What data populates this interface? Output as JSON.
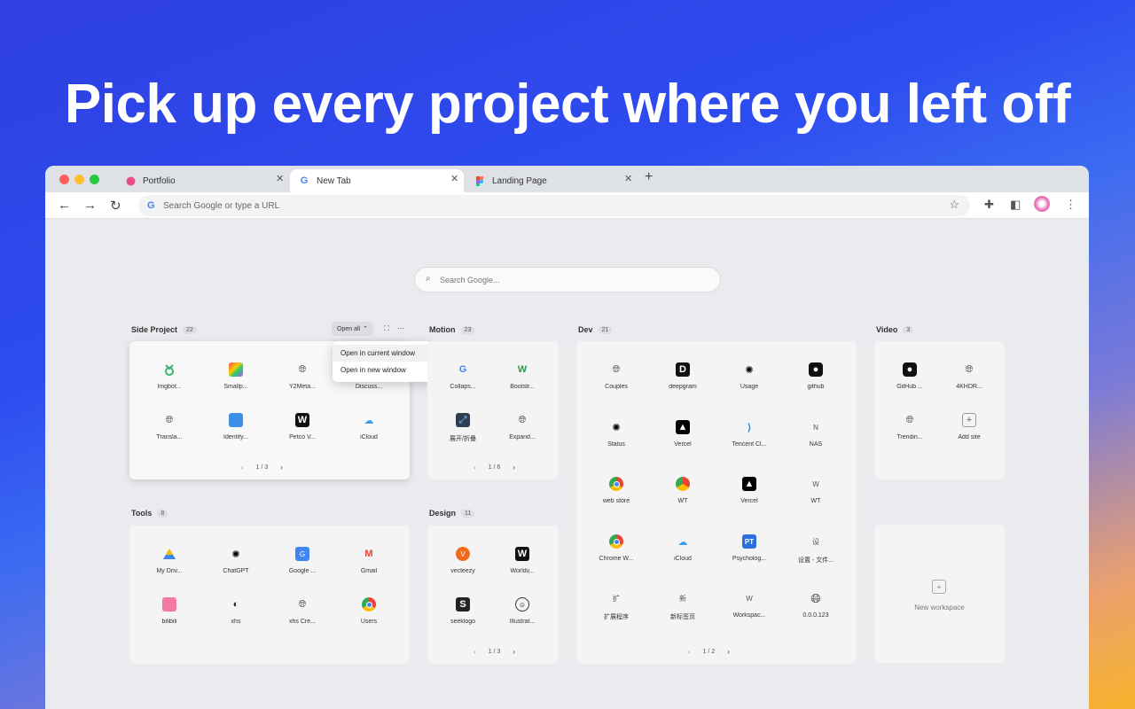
{
  "headline": "Pick up every project where you left off",
  "tabs": [
    {
      "label": "Portfolio",
      "icon": "dribbble-icon"
    },
    {
      "label": "New Tab",
      "icon": "google-icon"
    },
    {
      "label": "Landing Page",
      "icon": "figma-icon"
    }
  ],
  "omnibox": {
    "placeholder": "Search Google or type a URL"
  },
  "search": {
    "placeholder": "Search Google..."
  },
  "open_all": {
    "label": "Open all",
    "menu": [
      "Open in current window",
      "Open in new window"
    ]
  },
  "groups": [
    {
      "name": "Side Project",
      "count": "22",
      "page": "1 / 3",
      "items": [
        "Imgbot...",
        "Smallp...",
        "Y2Meta...",
        "Discuss...",
        "Transla...",
        "Identify...",
        "Petco V...",
        "iCloud"
      ]
    },
    {
      "name": "Motion",
      "count": "23",
      "page": "1 / 6",
      "items": [
        "Collaps...",
        "Bootstr...",
        "展开/折叠",
        "Expand..."
      ]
    },
    {
      "name": "Dev",
      "count": "21",
      "page": "1 / 2",
      "items": [
        "Couples",
        "deepgram",
        "Usage",
        "github",
        "Status",
        "Vercel",
        "Tencent Cl...",
        "NAS",
        "web store",
        "WT",
        "Vercel",
        "WT",
        "Chrome W...",
        "iCloud",
        "Psycholog...",
        "设置 - 文件...",
        "扩展程序",
        "新标签页",
        "Workspac...",
        "0.0.0.123"
      ]
    },
    {
      "name": "Video",
      "count": "3",
      "items": [
        "GitHub ...",
        "4KHDR...",
        "Trendin...",
        "Add site"
      ]
    },
    {
      "name": "Tools",
      "count": "8",
      "items": [
        "My Driv...",
        "ChatGPT",
        "Google ...",
        "Gmail",
        "bilibili",
        "xhs",
        "xhs Cre...",
        "Users"
      ]
    },
    {
      "name": "Design",
      "count": "11",
      "page": "1 / 3",
      "items": [
        "vecteezy",
        "Worldv...",
        "seeklogo",
        "Illustrat..."
      ]
    }
  ],
  "new_workspace": "New workspace",
  "glyphs": {
    "g": "G",
    "w": "W",
    "n": "N",
    "wt": "W",
    "she": "设",
    "kuo": "扩",
    "xin": "新",
    "s": "S",
    "pt": "PT",
    "ww": "W",
    "plus": "+",
    "star": "☆",
    "menu_dots": "⋮",
    "more": "⋯"
  }
}
